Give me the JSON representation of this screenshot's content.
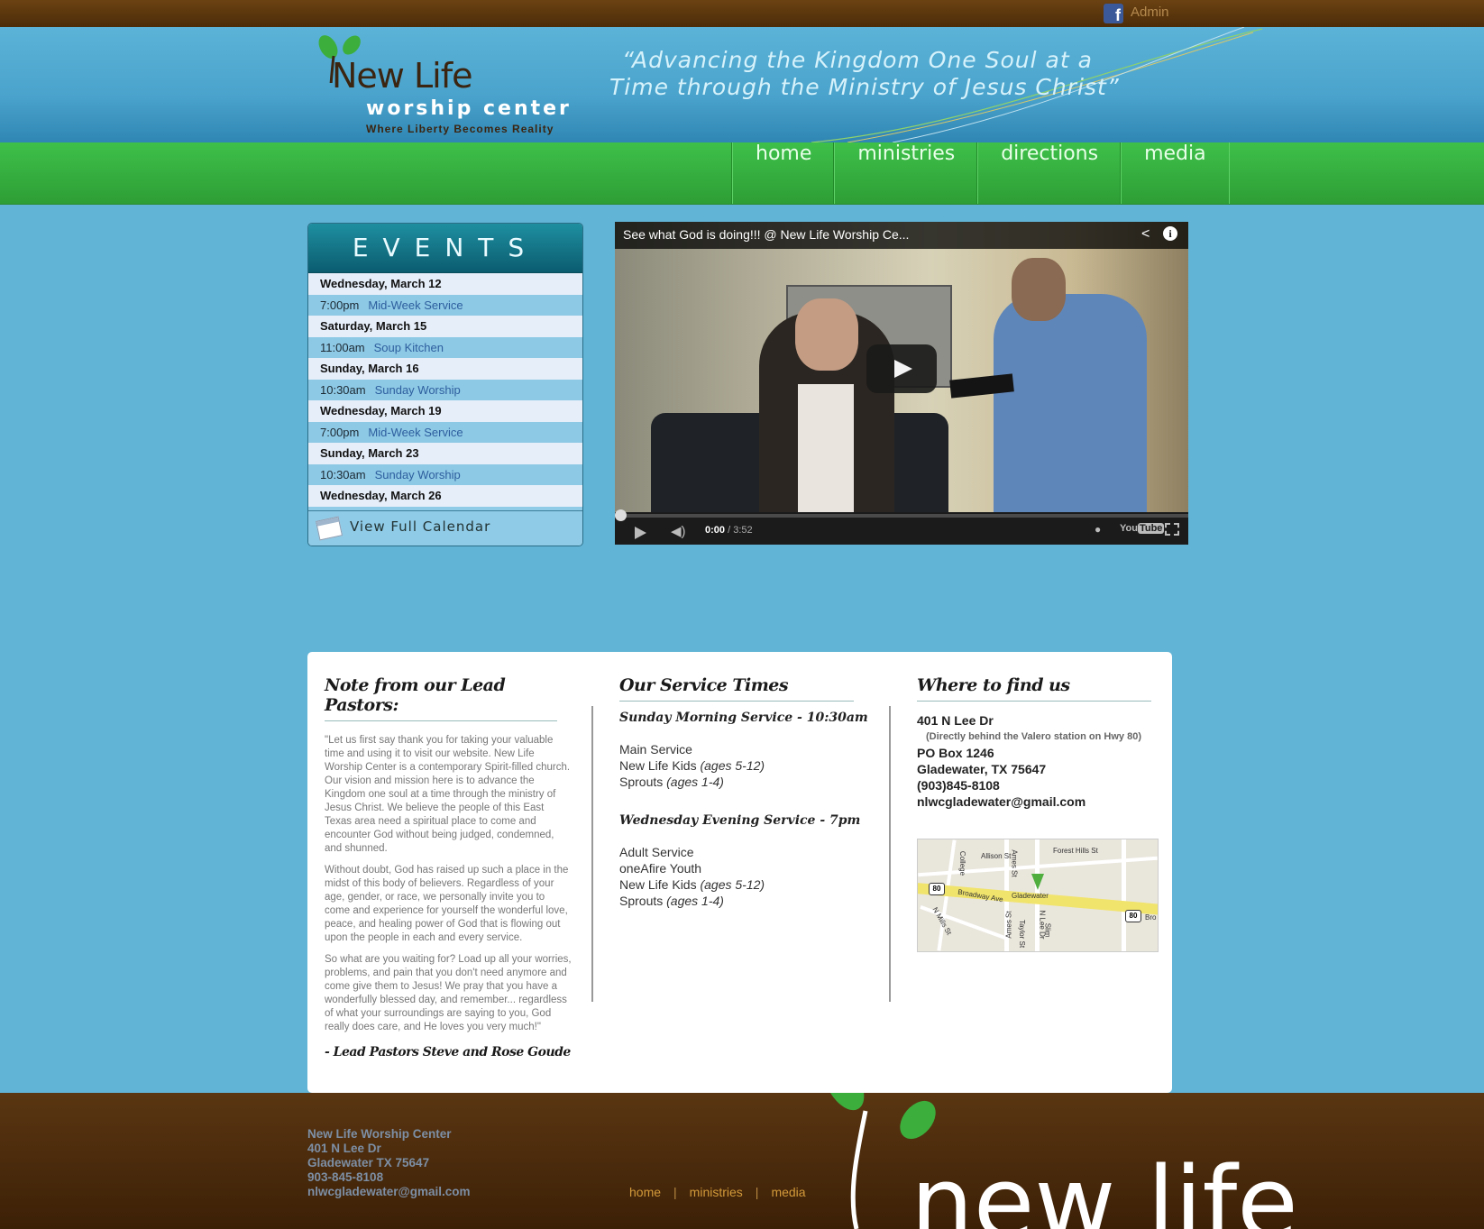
{
  "topbar": {
    "admin_label": "Admin"
  },
  "header": {
    "logo": {
      "name": "New Life",
      "subtitle": "worship center",
      "tagline": "Where Liberty Becomes Reality"
    },
    "motto_line1": "“Advancing the Kingdom One Soul at a",
    "motto_line2": "Time through the Ministry of Jesus Christ”"
  },
  "nav": {
    "items": [
      {
        "label": "home"
      },
      {
        "label": "ministries"
      },
      {
        "label": "directions"
      },
      {
        "label": "media"
      }
    ]
  },
  "events": {
    "title": "EVENTS",
    "rows": [
      {
        "date": "Wednesday, March 12",
        "time": "7:00pm",
        "event": "Mid-Week Service"
      },
      {
        "date": "Saturday, March 15",
        "time": "11:00am",
        "event": "Soup Kitchen"
      },
      {
        "date": "Sunday, March 16",
        "time": "10:30am",
        "event": "Sunday Worship"
      },
      {
        "date": "Wednesday, March 19",
        "time": "7:00pm",
        "event": "Mid-Week Service"
      },
      {
        "date": "Sunday, March 23",
        "time": "10:30am",
        "event": "Sunday Worship"
      },
      {
        "date": "Wednesday, March 26"
      }
    ],
    "footer_label": "View Full Calendar"
  },
  "video": {
    "title": "See what God is doing!!! @ New Life Worship Ce...",
    "current_time": "0:00",
    "duration": "/ 3:52",
    "brand": "You",
    "brand_box": "Tube",
    "progress": 0
  },
  "content": {
    "pastors": {
      "heading": "Note from our Lead Pastors:",
      "paragraphs": [
        "\"Let us first say thank you for taking your valuable time and using it to visit our website. New Life Worship Center is a contemporary Spirit-filled church. Our vision and mission here is to advance the Kingdom one soul at a time through the ministry of Jesus Christ. We believe the people of this East Texas area need a spiritual place to come and encounter God without being judged, condemned, and shunned.",
        "Without doubt, God has raised up such a place in the midst of this body of believers. Regardless of your age, gender, or race, we personally invite you to come and experience for yourself the wonderful love, peace, and healing power of God that is flowing out upon the people in each and every service.",
        "So what are you waiting for? Load up all your worries, problems, and pain that you don't need anymore and come give them to Jesus! We pray that you have a wonderfully blessed day, and remember... regardless of what your surroundings are saying to you, God really does care, and He loves you very much!\""
      ],
      "signature": "- Lead Pastors Steve and Rose Goude"
    },
    "services": {
      "heading": "Our Service Times",
      "sunday_heading": "Sunday Morning Service - 10:30am",
      "sunday_items": [
        {
          "name": "Main Service",
          "ages": ""
        },
        {
          "name": "New Life Kids",
          "ages": "(ages 5-12)"
        },
        {
          "name": "Sprouts",
          "ages": "(ages 1-4)"
        }
      ],
      "wednesday_heading": "Wednesday Evening Service - 7pm",
      "wednesday_items": [
        {
          "name": "Adult Service",
          "ages": ""
        },
        {
          "name": "oneAfire Youth",
          "ages": ""
        },
        {
          "name": "New Life Kids",
          "ages": "(ages 5-12)"
        },
        {
          "name": "Sprouts",
          "ages": "(ages 1-4)"
        }
      ]
    },
    "location": {
      "heading": "Where to find us",
      "street": "401 N Lee Dr",
      "note": "(Directly behind the Valero station on Hwy 80)",
      "po_box": "PO Box 1246",
      "city": "Gladewater, TX 75647",
      "phone": "(903)845-8108",
      "email": "nlwcgladewater@gmail.com",
      "map_labels": {
        "allison": "Allison St",
        "forest": "Forest Hills St",
        "college": "College",
        "broadway": "Broadway Ave",
        "gladewater": "Gladewater",
        "ames1": "Ames St",
        "ames2": "Ames St",
        "mills": "N Mills St",
        "lee": "N Lee Dr",
        "taylor": "Taylor St",
        "slim": "Slim",
        "bro": "Bro",
        "hwy1": "80",
        "hwy2": "80"
      }
    }
  },
  "footer": {
    "name": "New Life Worship Center",
    "street": "401 N Lee Dr",
    "city": "Gladewater TX 75647",
    "phone": "903-845-8108",
    "email": "nlwcgladewater@gmail.com",
    "nav": [
      {
        "label": "home"
      },
      {
        "label": "ministries"
      },
      {
        "label": "media"
      }
    ],
    "separator": "|",
    "logo_text": "new life"
  },
  "colors": {
    "topbar": "#5a3612",
    "header": "#4aa3cc",
    "nav_green": "#36b040",
    "page_bg": "#62b4d6",
    "footer": "#4a2a0a"
  }
}
